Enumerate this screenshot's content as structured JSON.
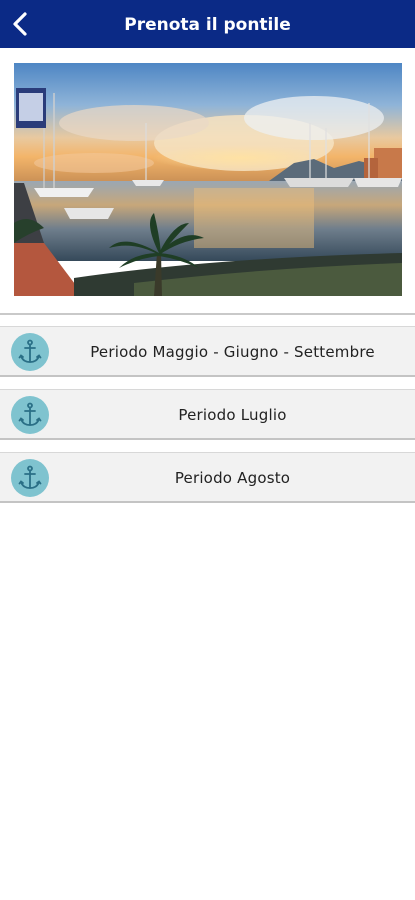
{
  "header": {
    "title": "Prenota il pontile",
    "back_icon": "chevron-left-icon",
    "background": "#0b2a86"
  },
  "hero": {
    "description": "harbor-sunset-photo"
  },
  "periods": [
    {
      "label": "Periodo Maggio - Giugno - Settembre",
      "icon": "anchor-icon"
    },
    {
      "label": "Periodo Luglio",
      "icon": "anchor-icon"
    },
    {
      "label": "Periodo Agosto",
      "icon": "anchor-icon"
    }
  ],
  "colors": {
    "accent": "#0b2a86",
    "anchor_circle": "#7fc3cf",
    "anchor_glyph": "#2a6f86",
    "list_background": "#f2f2f2"
  }
}
